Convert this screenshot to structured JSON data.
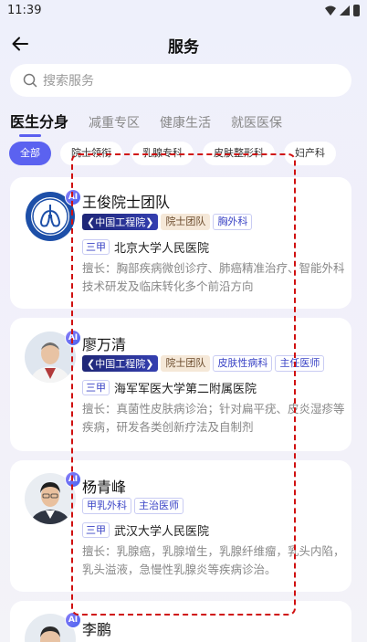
{
  "status_bar": {
    "time": "11:39"
  },
  "header": {
    "title": "服务"
  },
  "search": {
    "placeholder": "搜索服务"
  },
  "tabs": [
    {
      "label": "医生分身",
      "active": true
    },
    {
      "label": "减重专区"
    },
    {
      "label": "健康生活"
    },
    {
      "label": "就医医保"
    }
  ],
  "chips": [
    {
      "label": "全部",
      "active": true
    },
    {
      "label": "院士领衔"
    },
    {
      "label": "乳腺专科"
    },
    {
      "label": "皮肤整形科"
    },
    {
      "label": "妇产科"
    }
  ],
  "ai_badge": "AI",
  "doctors": [
    {
      "name": "王俊院士团队",
      "cae_label": "中国工程院",
      "tags": [
        "院士团队",
        "胸外科"
      ],
      "grade": "三甲",
      "hospital": "北京大学人民医院",
      "desc": "擅长：胸部疾病微创诊疗、肺癌精准治疗、智能外科技术研发及临床转化多个前沿方向"
    },
    {
      "name": "廖万清",
      "cae_label": "中国工程院",
      "tags": [
        "院士团队",
        "皮肤性病科",
        "主任医师"
      ],
      "grade": "三甲",
      "hospital": "海军军医大学第二附属医院",
      "desc": "擅长：真菌性皮肤病诊治；针对扁平疣、皮炎湿疹等疾病，研发各类创新疗法及自制剂"
    },
    {
      "name": "杨青峰",
      "tags": [
        "甲乳外科",
        "主治医师"
      ],
      "grade": "三甲",
      "hospital": "武汉大学人民医院",
      "desc": "擅长：乳腺癌，乳腺增生，乳腺纤维瘤，乳头内陷，乳头溢液，急慢性乳腺炎等疾病诊治。"
    },
    {
      "name": "李鹏"
    }
  ],
  "colors": {
    "accent": "#5b62f0",
    "annotation": "#d01010"
  }
}
